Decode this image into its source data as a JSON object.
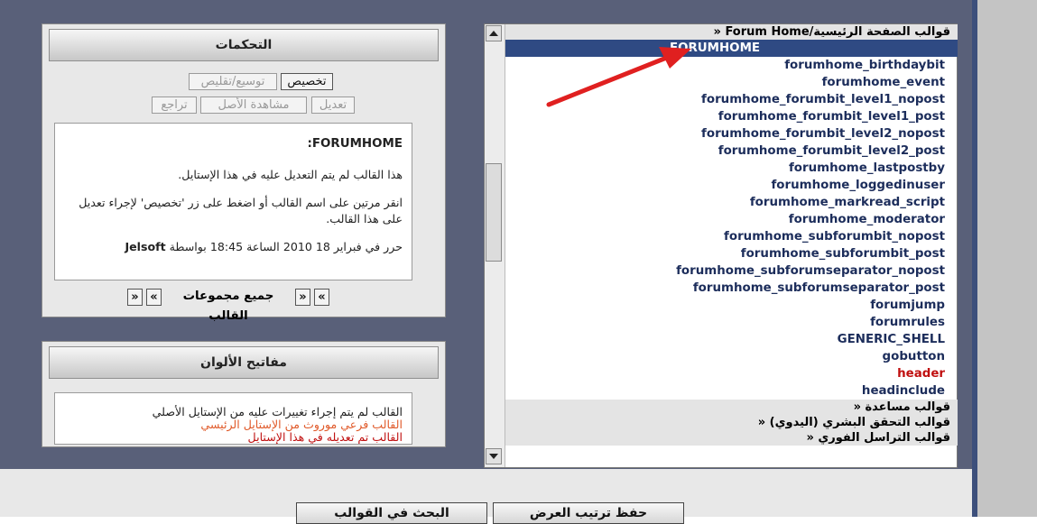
{
  "templates": {
    "group_header": "قوالب الصفحة الرئيسية/Forum Home «",
    "items": [
      {
        "name": "FORUMHOME",
        "selected": true,
        "modified": false
      },
      {
        "name": "forumhome_birthdaybit",
        "selected": false,
        "modified": false
      },
      {
        "name": "forumhome_event",
        "selected": false,
        "modified": false
      },
      {
        "name": "forumhome_forumbit_level1_nopost",
        "selected": false,
        "modified": false
      },
      {
        "name": "forumhome_forumbit_level1_post",
        "selected": false,
        "modified": false
      },
      {
        "name": "forumhome_forumbit_level2_nopost",
        "selected": false,
        "modified": false
      },
      {
        "name": "forumhome_forumbit_level2_post",
        "selected": false,
        "modified": false
      },
      {
        "name": "forumhome_lastpostby",
        "selected": false,
        "modified": false
      },
      {
        "name": "forumhome_loggedinuser",
        "selected": false,
        "modified": false
      },
      {
        "name": "forumhome_markread_script",
        "selected": false,
        "modified": false
      },
      {
        "name": "forumhome_moderator",
        "selected": false,
        "modified": false
      },
      {
        "name": "forumhome_subforumbit_nopost",
        "selected": false,
        "modified": false
      },
      {
        "name": "forumhome_subforumbit_post",
        "selected": false,
        "modified": false
      },
      {
        "name": "forumhome_subforumseparator_nopost",
        "selected": false,
        "modified": false
      },
      {
        "name": "forumhome_subforumseparator_post",
        "selected": false,
        "modified": false
      },
      {
        "name": "forumjump",
        "selected": false,
        "modified": false
      },
      {
        "name": "forumrules",
        "selected": false,
        "modified": false
      },
      {
        "name": "GENERIC_SHELL",
        "selected": false,
        "modified": false
      },
      {
        "name": "gobutton",
        "selected": false,
        "modified": false
      },
      {
        "name": "header",
        "selected": false,
        "modified": true
      },
      {
        "name": "headinclude",
        "selected": false,
        "modified": false
      }
    ],
    "groups_after": [
      "قوالب مساعدة «",
      "قوالب التحقق البشري (اليدوي) «",
      "قوالب التراسل الفوري «"
    ]
  },
  "controls": {
    "title": "التحكمات",
    "customize": "تخصيص",
    "expand_collapse": "توسيع/تقليص",
    "edit": "تعديل",
    "view_original": "مشاهدة الأصل",
    "revert": "تراجع",
    "info_title": ":FORUMHOME",
    "info_line1": "هذا القالب لم يتم التعديل عليه في هذا الإستايل.",
    "info_line2": "انقر مرتين على اسم القالب أو اضغط على زر 'تخصيص' لإجراء تعديل على هذا القالب.",
    "info_edited_prefix": "حرر في فبراير 18 2010 الساعة 18:45 بواسطة",
    "info_edited_by": "Jelsoft",
    "all_groups": "جميع مجموعات القالب",
    "chev_left": "«",
    "chev_right": "»"
  },
  "legend": {
    "title": "مفاتيح الألوان",
    "line1": "القالب لم يتم إجراء تغييرات عليه من الإستايل الأصلي",
    "line2": "القالب فرعي موروث من الإستايل الرئيسي",
    "line3": "القالب تم تعديله في هذا الإستايل",
    "colors": {
      "unchanged": "#222222",
      "inherited": "#e05a2a",
      "customized": "#c01010"
    }
  },
  "bottom": {
    "save_order": "حفظ ترتيب العرض",
    "search_templates": "البحث في القوالب"
  },
  "colors": {
    "selected_bg": "#2f4a83",
    "arrow": "#e02020"
  }
}
